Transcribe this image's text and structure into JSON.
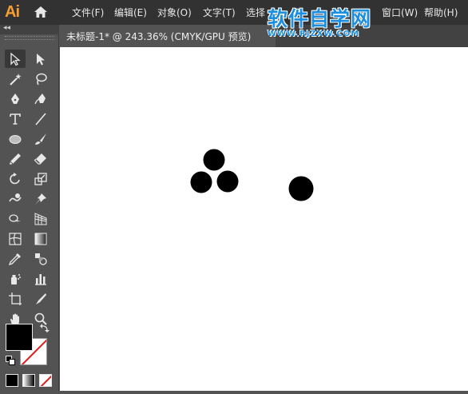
{
  "app": {
    "logo": "Ai",
    "accent": "#f79d32"
  },
  "menu": [
    {
      "label": "文件(F)"
    },
    {
      "label": "编辑(E)"
    },
    {
      "label": "对象(O)"
    },
    {
      "label": "文字(T)"
    },
    {
      "label": "选择"
    },
    {
      "label": "窗口(W)"
    },
    {
      "label": "帮助(H)"
    }
  ],
  "watermark": {
    "title": "软件自学网",
    "url": "WWW.RJZXW.COM",
    "color": "#1b8ee0"
  },
  "toolpanel": {
    "collapse_label": "◂◂"
  },
  "document": {
    "tab_title": "未标题-1* @ 243.36% (CMYK/GPU 预览)"
  },
  "colors": {
    "fill": "#000000",
    "stroke": "none",
    "circle_fill": "#000000"
  },
  "tools": [
    "selection-tool",
    "direct-selection-tool",
    "magic-wand-tool",
    "lasso-tool",
    "pen-tool",
    "curvature-tool",
    "type-tool",
    "line-segment-tool",
    "ellipse-tool",
    "paintbrush-tool",
    "pencil-tool",
    "eraser-tool",
    "rotate-tool",
    "scale-tool",
    "warp-tool",
    "puppet-warp-tool",
    "shape-builder-tool",
    "perspective-grid-tool",
    "mesh-tool",
    "gradient-tool",
    "eyedropper-tool",
    "blend-tool",
    "symbol-sprayer-tool",
    "column-graph-tool",
    "artboard-tool",
    "slice-tool",
    "hand-tool",
    "zoom-tool"
  ]
}
